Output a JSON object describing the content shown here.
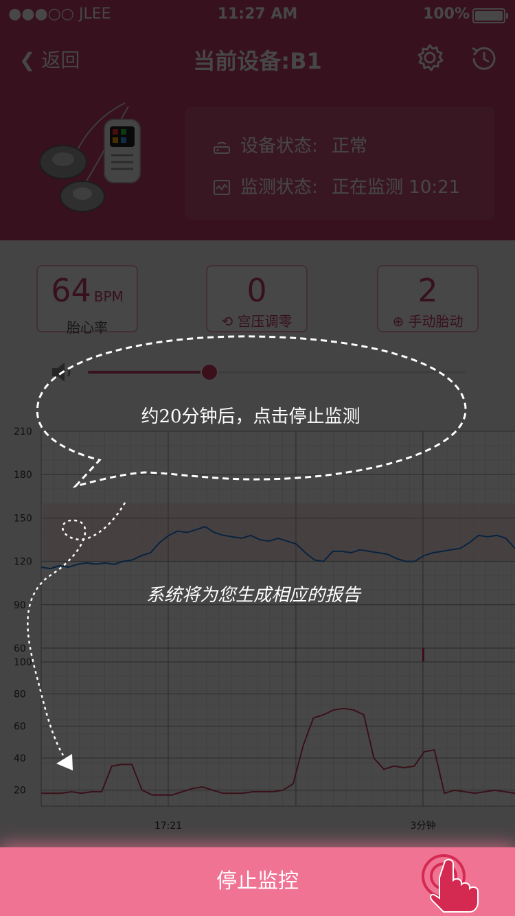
{
  "status_bar": {
    "carrier": "●●●○○ JLEE",
    "time": "11:27 AM",
    "battery": "100%"
  },
  "nav": {
    "back_label": "返回",
    "title": "当前设备:B1",
    "icons": [
      "gear-icon",
      "history-icon"
    ]
  },
  "device": {
    "device_status_label": "设备状态:",
    "device_status_value": "正常",
    "monitor_status_label": "监测状态:",
    "monitor_status_value": "正在监测 10:21"
  },
  "metrics": [
    {
      "value": "64",
      "unit": "BPM",
      "label": "胎心率"
    },
    {
      "value": "0",
      "label": "宫压调零"
    },
    {
      "value": "2",
      "label": "手动胎动"
    }
  ],
  "volume": {
    "level": 0.32
  },
  "fhr_chart": {
    "y_ticks": [
      "210",
      "180",
      "150",
      "120",
      "90",
      "60"
    ]
  },
  "toco_chart": {
    "y_ticks": [
      "100",
      "80",
      "60",
      "40",
      "20"
    ],
    "x_ticks": [
      "17:21",
      "3分钟"
    ]
  },
  "chart_data": [
    {
      "type": "line",
      "series": [
        {
          "values": [
            116,
            115,
            117,
            116,
            118,
            119,
            118,
            119,
            118,
            120,
            121,
            124,
            126,
            133,
            138,
            141,
            140,
            142,
            144,
            140,
            138,
            137,
            136,
            138,
            135,
            134,
            136,
            134,
            132,
            126,
            121,
            120,
            127,
            127,
            126,
            128,
            127,
            126,
            125,
            122,
            120,
            120,
            124,
            126,
            127,
            128,
            129,
            133,
            138,
            137,
            138,
            136,
            129
          ]
        }
      ],
      "ylim": [
        60,
        210
      ],
      "markers": [
        3,
        5.5
      ]
    },
    {
      "type": "line",
      "series": [
        {
          "values": [
            18,
            18,
            18,
            19,
            18,
            19,
            19,
            35,
            36,
            36,
            20,
            17,
            17,
            17,
            19,
            21,
            22,
            20,
            18,
            18,
            18,
            19,
            19,
            19,
            20,
            24,
            48,
            65,
            67,
            70,
            71,
            70,
            67,
            40,
            33,
            35,
            34,
            35,
            44,
            45,
            18,
            20,
            19,
            18,
            19,
            20,
            19,
            18
          ]
        }
      ],
      "ylim": [
        10,
        100
      ]
    }
  ],
  "guide": {
    "bubble_text": "约20分钟后，点击停止监测",
    "report_text": "系统将为您生成相应的报告"
  },
  "bottom": {
    "stop_label": "停止监控"
  },
  "colors": {
    "brand": "#c43d68",
    "fhr_line": "#1e7fe0",
    "toco_line": "#d23a5a",
    "button": "#f07393"
  }
}
